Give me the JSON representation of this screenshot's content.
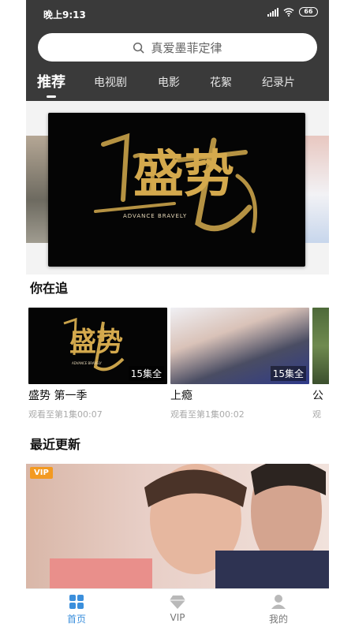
{
  "status": {
    "time": "晚上9:13",
    "battery": "66"
  },
  "search": {
    "placeholder": "真爱墨菲定律"
  },
  "tabs": [
    {
      "label": "推荐"
    },
    {
      "label": "电视剧"
    },
    {
      "label": "电影"
    },
    {
      "label": "花絮"
    },
    {
      "label": "纪录片"
    }
  ],
  "banner": {
    "logo_text": "盛势",
    "logo_subtitle": "ADVANCE BRAVELY"
  },
  "sections": {
    "following": "你在追",
    "recent": "最近更新"
  },
  "following": [
    {
      "title": "盛势 第一季",
      "episodes": "15集全",
      "progress": "观看至第1集00:07"
    },
    {
      "title": "上瘾",
      "episodes": "15集全",
      "progress": "观看至第1集00:02"
    },
    {
      "title": "公",
      "episodes": "",
      "progress": "观"
    }
  ],
  "recent": {
    "badge": "VIP"
  },
  "nav": [
    {
      "label": "首页"
    },
    {
      "label": "VIP"
    },
    {
      "label": "我的"
    }
  ],
  "colors": {
    "header": "#3a3a3a",
    "accent": "#3b8fdc",
    "vip": "#f39a21",
    "gold": "#c9a24a"
  }
}
